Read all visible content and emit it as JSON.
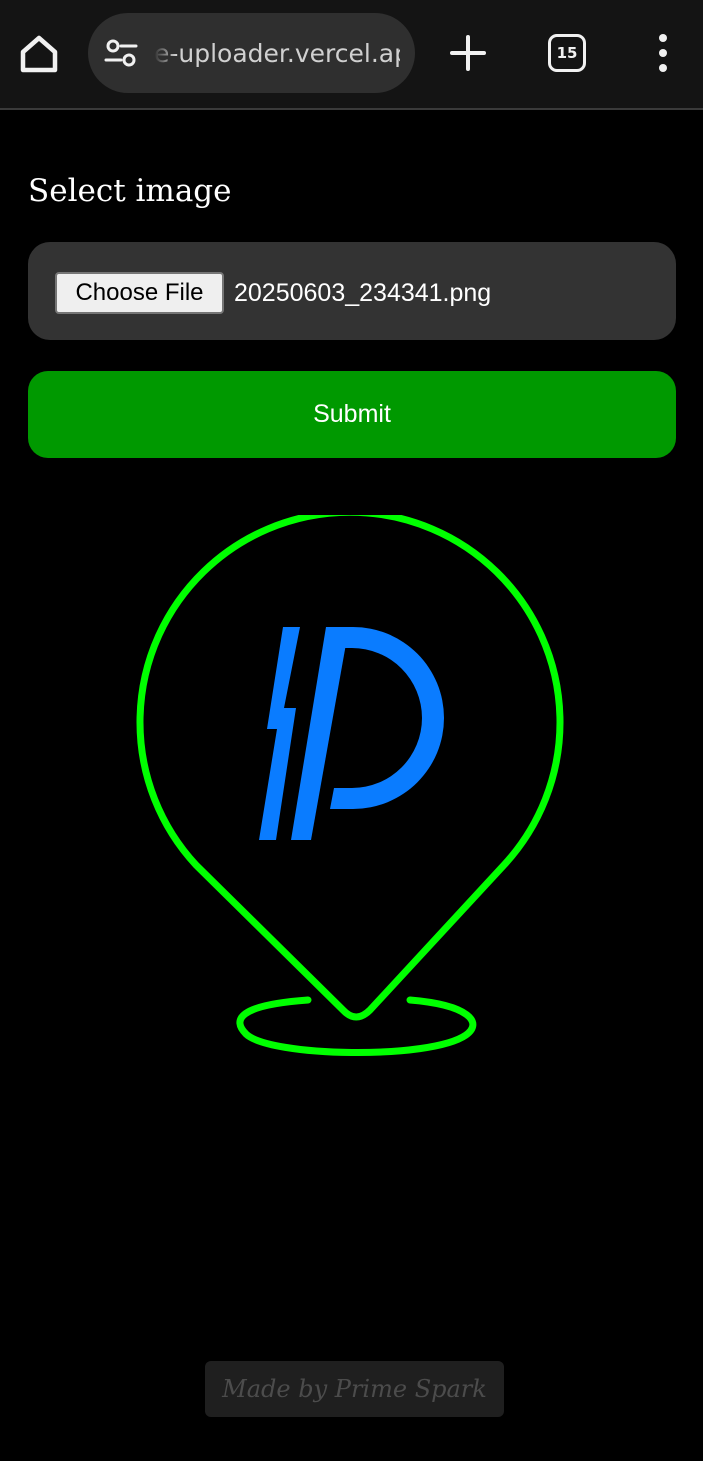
{
  "browser": {
    "url": "e-uploader.vercel.app",
    "tab_count": "15",
    "icons": {
      "home": "home-icon",
      "site_settings": "site-settings-icon",
      "new_tab": "plus-icon",
      "menu": "more-vert-icon"
    }
  },
  "form": {
    "label": "Select image",
    "choose_file_label": "Choose File",
    "selected_file": "20250603_234341.png",
    "submit_label": "Submit"
  },
  "footer": {
    "credit": "Made by Prime Spark"
  },
  "colors": {
    "background": "#000000",
    "submit": "#009900",
    "logo_outline": "#00ff00",
    "logo_mark": "#0a7cff",
    "file_box": "#333333"
  }
}
